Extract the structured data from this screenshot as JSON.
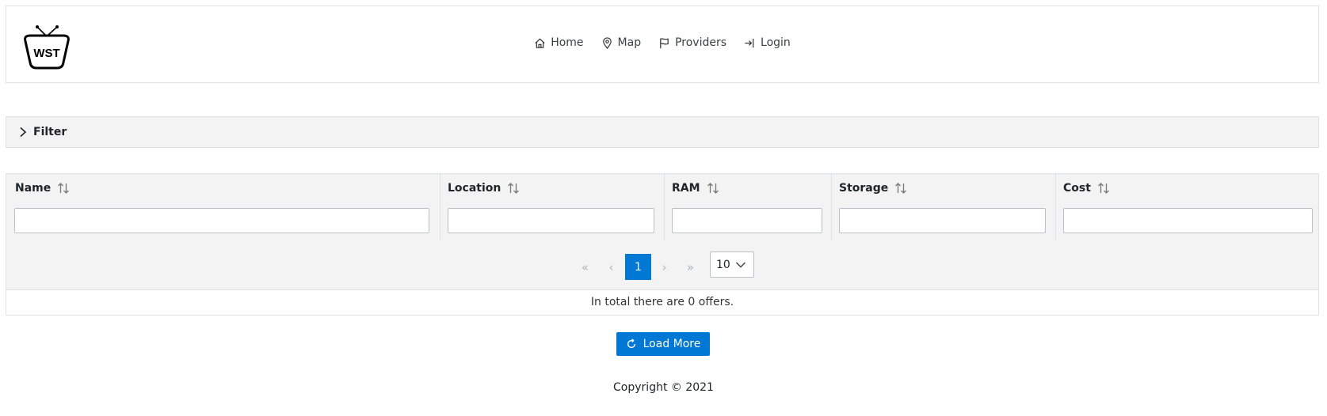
{
  "logo": {
    "text": "WST"
  },
  "nav": {
    "items": [
      {
        "label": "Home",
        "icon": "home-icon"
      },
      {
        "label": "Map",
        "icon": "map-pin-icon"
      },
      {
        "label": "Providers",
        "icon": "flag-icon"
      },
      {
        "label": "Login",
        "icon": "login-icon"
      }
    ]
  },
  "filter": {
    "label": "Filter"
  },
  "table": {
    "columns": [
      {
        "label": "Name",
        "filter_value": ""
      },
      {
        "label": "Location",
        "filter_value": ""
      },
      {
        "label": "RAM",
        "filter_value": ""
      },
      {
        "label": "Storage",
        "filter_value": ""
      },
      {
        "label": "Cost",
        "filter_value": ""
      }
    ]
  },
  "pager": {
    "first": "«",
    "prev": "‹",
    "page": "1",
    "next": "›",
    "last": "»",
    "page_size": "10"
  },
  "total_text": "In total there are 0 offers.",
  "load_more": {
    "label": "Load More"
  },
  "footer": {
    "copyright": "Copyright © 2021"
  },
  "colors": {
    "accent": "#0078d4",
    "panel": "#f3f3f3",
    "border": "#dee2e6"
  }
}
